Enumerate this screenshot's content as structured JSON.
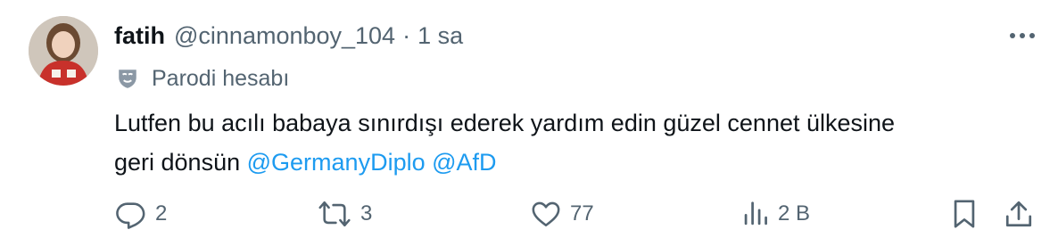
{
  "tweet": {
    "display_name": "fatih",
    "handle": "@cinnamonboy_104",
    "separator": "·",
    "time": "1 sa",
    "label_text": "Parodi hesabı",
    "text_line1": "Lutfen bu acılı babaya sınırdışı ederek yardım edin güzel cennet ülkesine",
    "text_line2_start": "geri dönsün",
    "mentions": [
      "@GermanyDiplo",
      "@AfD"
    ]
  },
  "actions": {
    "replies": "2",
    "reposts": "3",
    "likes": "77",
    "views": "2 B"
  },
  "colors": {
    "text": "#0f1419",
    "secondary": "#536471",
    "link": "#1d9bf0",
    "background": "#ffffff"
  },
  "icons": [
    "avatar",
    "more-icon",
    "parody-mask-icon",
    "reply-icon",
    "repost-icon",
    "like-icon",
    "views-icon",
    "bookmark-icon",
    "share-icon"
  ]
}
